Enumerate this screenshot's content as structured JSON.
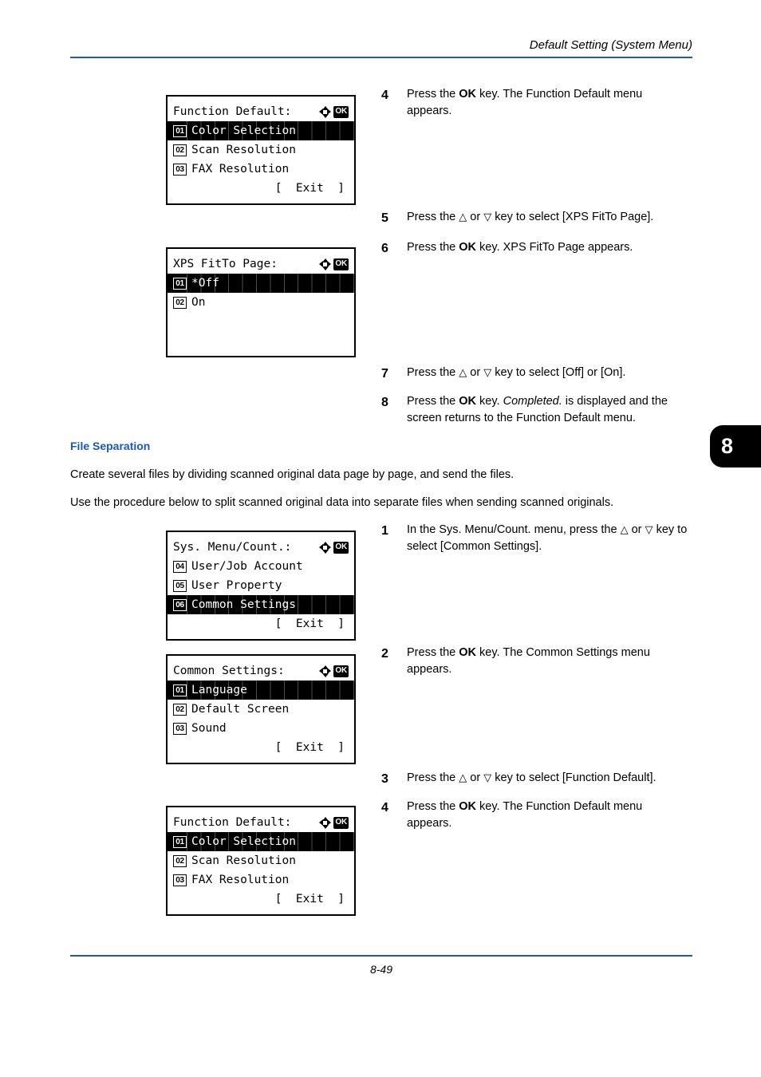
{
  "header": {
    "title": "Default Setting (System Menu)"
  },
  "footer": {
    "page_number": "8-49"
  },
  "chapter_tab": {
    "number": "8"
  },
  "section": {
    "heading": "File Separation",
    "paragraph_1": "Create several files by dividing scanned original data page by page, and send the files.",
    "paragraph_2": "Use the procedure below to split scanned original data into separate files when sending scanned originals."
  },
  "icons": {
    "four_way_arrow": "four-way-arrow-icon",
    "ok_badge_label": "OK"
  },
  "panels": {
    "function_default_top": {
      "title": "Function Default:",
      "rows": [
        {
          "badge": "01",
          "label": "Color Selection",
          "selected": true
        },
        {
          "badge": "02",
          "label": "Scan Resolution",
          "selected": false
        },
        {
          "badge": "03",
          "label": "FAX Resolution",
          "selected": false
        }
      ],
      "exit": "[  Exit  ]"
    },
    "xps_fitto_page": {
      "title": "XPS FitTo Page:",
      "rows": [
        {
          "badge": "01",
          "label": "*Off",
          "selected": true
        },
        {
          "badge": "02",
          "label": "On",
          "selected": false
        }
      ],
      "exit": ""
    },
    "sys_menu_count": {
      "title": "Sys. Menu/Count.:",
      "rows": [
        {
          "badge": "04",
          "label": "User/Job Account",
          "selected": false
        },
        {
          "badge": "05",
          "label": "User Property",
          "selected": false
        },
        {
          "badge": "06",
          "label": "Common Settings",
          "selected": true
        }
      ],
      "exit": "[  Exit  ]"
    },
    "common_settings": {
      "title": "Common Settings:",
      "rows": [
        {
          "badge": "01",
          "label": "Language",
          "selected": true
        },
        {
          "badge": "02",
          "label": "Default Screen",
          "selected": false
        },
        {
          "badge": "03",
          "label": "Sound",
          "selected": false
        }
      ],
      "exit": "[  Exit  ]"
    },
    "function_default_bottom": {
      "title": "Function Default:",
      "rows": [
        {
          "badge": "01",
          "label": "Color Selection",
          "selected": true
        },
        {
          "badge": "02",
          "label": "Scan Resolution",
          "selected": false
        },
        {
          "badge": "03",
          "label": "FAX Resolution",
          "selected": false
        }
      ],
      "exit": "[  Exit  ]"
    }
  },
  "steps_upper": [
    {
      "number": "4",
      "parts": [
        {
          "t": "Press the ",
          "s": "n"
        },
        {
          "t": "OK",
          "s": "b"
        },
        {
          "t": " key. The Function Default menu appears.",
          "s": "n"
        }
      ]
    },
    {
      "number": "5",
      "parts": [
        {
          "t": "Press the ",
          "s": "n"
        },
        {
          "t": "△",
          "s": "g"
        },
        {
          "t": " or ",
          "s": "n"
        },
        {
          "t": "▽",
          "s": "g"
        },
        {
          "t": " key to select [XPS FitTo Page].",
          "s": "n"
        }
      ]
    },
    {
      "number": "6",
      "parts": [
        {
          "t": "Press the ",
          "s": "n"
        },
        {
          "t": "OK",
          "s": "b"
        },
        {
          "t": " key. XPS FitTo Page appears.",
          "s": "n"
        }
      ]
    },
    {
      "number": "7",
      "parts": [
        {
          "t": "Press the ",
          "s": "n"
        },
        {
          "t": "△",
          "s": "g"
        },
        {
          "t": " or ",
          "s": "n"
        },
        {
          "t": "▽",
          "s": "g"
        },
        {
          "t": " key to select [Off] or [On].",
          "s": "n"
        }
      ]
    },
    {
      "number": "8",
      "parts": [
        {
          "t": "Press the ",
          "s": "n"
        },
        {
          "t": "OK",
          "s": "b"
        },
        {
          "t": " key. ",
          "s": "n"
        },
        {
          "t": "Completed.",
          "s": "i"
        },
        {
          "t": " is displayed and the screen returns to the Function Default menu.",
          "s": "n"
        }
      ]
    }
  ],
  "steps_lower": [
    {
      "number": "1",
      "parts": [
        {
          "t": "In the Sys. Menu/Count. menu, press the ",
          "s": "n"
        },
        {
          "t": "△",
          "s": "g"
        },
        {
          "t": " or ",
          "s": "n"
        },
        {
          "t": "▽",
          "s": "g"
        },
        {
          "t": " key to select [Common Settings].",
          "s": "n"
        }
      ]
    },
    {
      "number": "2",
      "parts": [
        {
          "t": "Press the ",
          "s": "n"
        },
        {
          "t": "OK",
          "s": "b"
        },
        {
          "t": " key. The Common Settings menu appears.",
          "s": "n"
        }
      ]
    },
    {
      "number": "3",
      "parts": [
        {
          "t": "Press the ",
          "s": "n"
        },
        {
          "t": "△",
          "s": "g"
        },
        {
          "t": " or ",
          "s": "n"
        },
        {
          "t": "▽",
          "s": "g"
        },
        {
          "t": " key to select [Function Default].",
          "s": "n"
        }
      ]
    },
    {
      "number": "4",
      "parts": [
        {
          "t": "Press the ",
          "s": "n"
        },
        {
          "t": "OK",
          "s": "b"
        },
        {
          "t": " key. The Function Default menu appears.",
          "s": "n"
        }
      ]
    }
  ],
  "colors": {
    "accent_blue": "#1a57c4",
    "ink": "#000000",
    "paper": "#ffffff"
  }
}
